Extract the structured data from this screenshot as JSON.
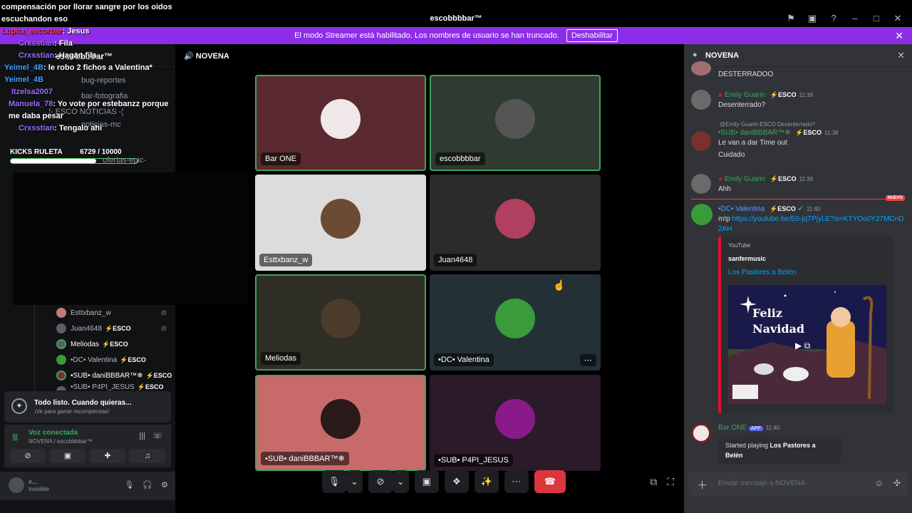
{
  "window": {
    "title": "escobbbbar™",
    "icons": [
      "⚑",
      "▣",
      "?",
      "–",
      "□",
      "✕"
    ]
  },
  "streamer": {
    "text": "El modo Streamer está habilitado. Los nombres de usuario se han truncado.",
    "button": "Deshabilitar"
  },
  "overlay_chat": [
    {
      "text": "compensación por llorar sangre por los oidos",
      "style": ""
    },
    {
      "text": "escuchandon eso",
      "style": ""
    },
    {
      "user": "Lupita_escorbar",
      "text": ": Jesus",
      "style": "u1"
    },
    {
      "user": "Crxsstian",
      "text": ": Fila",
      "style": "u2"
    },
    {
      "user": "Crxsstian",
      "text": ": Hagan fila",
      "style": "u2"
    },
    {
      "user": "Yeimel_4B",
      "text": ": le robo 2 fichos a Valentina*",
      "style": "u3"
    },
    {
      "user": "Yeimel_4B",
      "text": "",
      "style": "u3"
    },
    {
      "user": "Itzelsa2007",
      "text": "",
      "style": "u2"
    },
    {
      "user": "Manuela_78",
      "text": ": Yo vote por estebanzz porque me daba pesar",
      "style": "u2"
    },
    {
      "user": "Crxsstian",
      "text": ": Tengalo ahi",
      "style": "u2"
    }
  ],
  "server": {
    "name": "escobbbbar™"
  },
  "channels": [
    "bug-reportes",
    "bar-fotografia",
    "¦- ESCO NOTICIAS -¦",
    "noticias-mc",
    "ofertas-epic-games"
  ],
  "kicks": {
    "label": "KICKS RULETA",
    "value": "6729",
    "max": "10000",
    "progress": 0.6729
  },
  "voice_users": [
    {
      "name": "Esttxbanz_w",
      "badge": "",
      "muted": true
    },
    {
      "name": "Juan4648",
      "badge": "ESCO",
      "muted": true
    },
    {
      "name": "Meliodas",
      "badge": "ESCO",
      "muted": false
    },
    {
      "name": "•DC• Valentina",
      "badge": "ESCO",
      "muted": false
    },
    {
      "name": "•SUB• daniBBBAR™❄",
      "badge": "ESCO",
      "muted": false
    },
    {
      "name": "•SUB• P4PI_JESUS",
      "badge": "ESCO",
      "muted": false
    }
  ],
  "popup": {
    "title": "Todo listo. Cuando quieras...",
    "sub": "¡Ve para ganar recompensas!"
  },
  "voice": {
    "status": "Voz conectada",
    "channel": "NOVENA / escobbbbar™"
  },
  "user": {
    "name": "e...",
    "status": "Invisible"
  },
  "center": {
    "channel": "NOVENA"
  },
  "tiles": [
    {
      "label": "Bar ONE",
      "bg": "#5a2a30",
      "av": "#f0e8e8",
      "speaking": true
    },
    {
      "label": "escobbbbar",
      "bg": "#2f3a30",
      "av": "#555555",
      "speaking": true
    },
    {
      "label": "Esttxbanz_w",
      "bg": "#dcdcdc",
      "av": "#6b4a33",
      "speaking": false
    },
    {
      "label": "Juan4648",
      "bg": "#2b2b2b",
      "av": "#b04060",
      "speaking": false
    },
    {
      "label": "Meliodas",
      "bg": "#2e2e26",
      "av": "#4a3b2a",
      "speaking": true
    },
    {
      "label": "•DC• Valentina",
      "bg": "#233035",
      "av": "#3a9b3a",
      "speaking": false
    },
    {
      "label": "•SUB• daniBBBAR™❄",
      "bg": "#c96a6a",
      "av": "#2a1a1a",
      "speaking": true
    },
    {
      "label": "•SUB• P4PI_JESUS",
      "bg": "#2a1a2a",
      "av": "#8a1a8a",
      "speaking": false
    }
  ],
  "controls": [
    "🎙",
    "⌄",
    "⊘",
    "⌄",
    "▣",
    "❖",
    "✨",
    "⋯",
    "☎"
  ],
  "chat": {
    "title": "NOVENA",
    "msg0": "DESTERRADOO",
    "m1": {
      "user": "Emily Guarin",
      "badge": "ESCO",
      "time": "11:38",
      "text": "Desenterrado?"
    },
    "m2": {
      "reply": "@Emily Guarin ESCO Desenterrado?",
      "user": "•SUB• daniBBBAR™❄",
      "badge": "ESCO",
      "time": "11:38",
      "l1": "Le van a dar Time out",
      "l2": "Cuidado"
    },
    "m3": {
      "user": "Emily Guarin",
      "badge": "ESCO",
      "time": "11:38",
      "text": "Ahh"
    },
    "nuevo": "NUEVO",
    "m4": {
      "user": "•DC• Valentina",
      "badge": "ESCO",
      "time": "11:40",
      "prefix": "m!p",
      "link": "https://youtube.be/E0-jqTPjyLE?si=KTYOo0Y27MCnD2AH"
    },
    "embed": {
      "provider": "YouTube",
      "author": "sanfermusic",
      "title": "Los Pastores a Belén",
      "thumb_text1": "Feliz",
      "thumb_text2": "Navidad"
    },
    "m5": {
      "user": "Bar ONE",
      "app": "APP",
      "time": "11:40",
      "text1": "Started playing ",
      "text2": "Los Pastores a Belén"
    },
    "placeholder": "Enviar mensaje a NOVENA"
  }
}
